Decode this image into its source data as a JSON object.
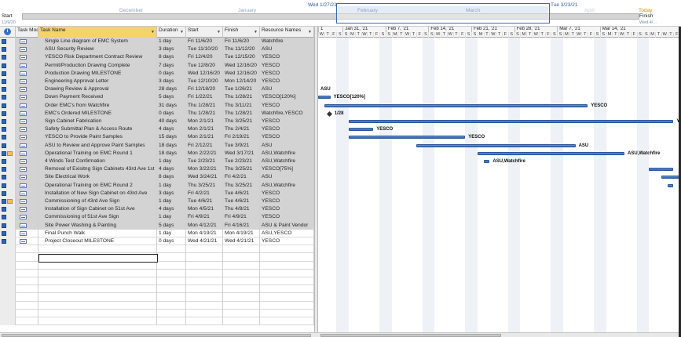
{
  "timeline": {
    "start_label": "Start",
    "start_date": "11/9/20",
    "finish_label": "Finish",
    "finish_date": "Wed 4/...",
    "today_label": "Today",
    "window_start": "Wed 1/27/21",
    "window_end": "Tue 3/23/21",
    "months": [
      "December",
      "January",
      "February",
      "March",
      "April"
    ]
  },
  "columns": {
    "mode": "Task Mode",
    "name": "Task Name",
    "duration": "Duration",
    "start": "Start",
    "finish": "Finish",
    "resource": "Resource Names"
  },
  "tasks": [
    {
      "name": "Single Line diagram of EMC System",
      "duration": "1 day",
      "start": "Fri 11/6/20",
      "finish": "Fri 11/6/20",
      "resource": "Watchfire",
      "note": false
    },
    {
      "name": "ASU Security Review",
      "duration": "3 days",
      "start": "Tue 11/10/20",
      "finish": "Thu 11/12/20",
      "resource": "ASU",
      "note": false
    },
    {
      "name": "YESCO Risk Department Contract Review",
      "duration": "8 days",
      "start": "Fri 12/4/20",
      "finish": "Tue 12/15/20",
      "resource": "YESCO",
      "note": false
    },
    {
      "name": "Permit/Production Drawing Complete",
      "duration": "7 days",
      "start": "Tue 12/8/20",
      "finish": "Wed 12/16/20",
      "resource": "YESCO",
      "note": false
    },
    {
      "name": "Production Drawing MILESTONE",
      "duration": "0 days",
      "start": "Wed 12/16/20",
      "finish": "Wed 12/16/20",
      "resource": "YESCO",
      "note": false
    },
    {
      "name": "Engineering Approval Letter",
      "duration": "3 days",
      "start": "Tue 12/10/20",
      "finish": "Mon 12/14/20",
      "resource": "YESCO",
      "note": false
    },
    {
      "name": "Drawing Review & Approval",
      "duration": "28 days",
      "start": "Fri 12/18/20",
      "finish": "Tue 1/26/21",
      "resource": "ASU",
      "note": false
    },
    {
      "name": "Down Payment Received",
      "duration": "5 days",
      "start": "Fri 1/22/21",
      "finish": "Thu 1/28/21",
      "resource": "YESCO[120%]",
      "note": false
    },
    {
      "name": "Order EMC's from Watchfire",
      "duration": "31 days",
      "start": "Thu 1/28/21",
      "finish": "Thu 3/11/21",
      "resource": "YESCO",
      "note": false
    },
    {
      "name": "EMC's Ordered MILESTONE",
      "duration": "0 days",
      "start": "Thu 1/28/21",
      "finish": "Thu 1/28/21",
      "resource": "Watchfire,YESCO",
      "note": false
    },
    {
      "name": "Sign Cabinet Fabrication",
      "duration": "40 days",
      "start": "Mon 2/1/21",
      "finish": "Thu 3/25/21",
      "resource": "YESCO",
      "note": false
    },
    {
      "name": "Safety Submittal Plan & Access Route",
      "duration": "4 days",
      "start": "Mon 2/1/21",
      "finish": "Thu 2/4/21",
      "resource": "YESCO",
      "note": false
    },
    {
      "name": "YESCO to Provide Paint Samples",
      "duration": "15 days",
      "start": "Mon 2/1/21",
      "finish": "Fri 2/19/21",
      "resource": "YESCO",
      "note": false
    },
    {
      "name": "ASU to Review and Approve Paint Samples",
      "duration": "18 days",
      "start": "Fri 2/12/21",
      "finish": "Tue 3/9/21",
      "resource": "ASU",
      "note": false
    },
    {
      "name": "Operational Training on EMC Round 1",
      "duration": "18 days",
      "start": "Mon 2/22/21",
      "finish": "Wed 3/17/21",
      "resource": "ASU,Watchfire",
      "note": true
    },
    {
      "name": "4 Winds Test Confirmation",
      "duration": "1 day",
      "start": "Tue 2/23/21",
      "finish": "Tue 2/23/21",
      "resource": "ASU,Watchfire",
      "note": false
    },
    {
      "name": "Removal of Exisitng Sign Cabinets 43rd Ave 1st",
      "duration": "4 days",
      "start": "Mon 3/22/21",
      "finish": "Thu 3/25/21",
      "resource": "YESCO[75%]",
      "note": false
    },
    {
      "name": "Site Electrical Work",
      "duration": "8 days",
      "start": "Wed 3/24/21",
      "finish": "Fri 4/2/21",
      "resource": "ASU",
      "note": false
    },
    {
      "name": "Operational Training on EMC Round 2",
      "duration": "1 day",
      "start": "Thu 3/25/21",
      "finish": "Thu 3/25/21",
      "resource": "ASU,Watchfire",
      "note": false
    },
    {
      "name": "Installation of New Sign Cabinet on 43rd Ave",
      "duration": "3 days",
      "start": "Fri 4/2/21",
      "finish": "Tue 4/6/21",
      "resource": "YESCO",
      "note": false
    },
    {
      "name": "Commissioning of 43rd Ave Sign",
      "duration": "1 day",
      "start": "Tue 4/6/21",
      "finish": "Tue 4/6/21",
      "resource": "YESCO",
      "note": true
    },
    {
      "name": "Installation of Sign Cabinet on 51st Ave",
      "duration": "4 days",
      "start": "Mon 4/5/21",
      "finish": "Thu 4/8/21",
      "resource": "YESCO",
      "note": false
    },
    {
      "name": "Commissioning of 51st Ave Sign",
      "duration": "1 day",
      "start": "Fri 4/9/21",
      "finish": "Fri 4/9/21",
      "resource": "YESCO",
      "note": false
    },
    {
      "name": "Site Power Washing & Painting",
      "duration": "5 days",
      "start": "Mon 4/12/21",
      "finish": "Fri 4/16/21",
      "resource": "ASU & Paint Vendor",
      "note": false
    },
    {
      "name": "Final Punch Walk",
      "duration": "1 day",
      "start": "Mon 4/19/21",
      "finish": "Mon 4/19/21",
      "resource": "ASU,YESCO",
      "note": false
    },
    {
      "name": "Project Closeout MILESTONE",
      "duration": "0 days",
      "start": "Wed 4/21/21",
      "finish": "Wed 4/21/21",
      "resource": "YESCO",
      "note": false
    }
  ],
  "gantt": {
    "first_day_label": "1",
    "weeks": [
      "Jan 31, '21",
      "Feb 7, '21",
      "Feb 14, '21",
      "Feb 21, '21",
      "Feb 28, '21",
      "Mar 7, '21",
      "Mar 14, '21"
    ],
    "day_letters": [
      "W",
      "T",
      "F",
      "S",
      "S",
      "M",
      "T"
    ],
    "milestone_label": "1/28",
    "bar_labels": [
      "ASU",
      "YESCO[120%]",
      "YESCO",
      "YESCO",
      "YESCO",
      "YESCO",
      "ASU",
      "ASU,Watchfire",
      "ASU,Watchfire"
    ]
  },
  "colors": {
    "bar": "#3a6fc4",
    "selected_header": "#f4d36b",
    "weekend": "#eef1f6"
  }
}
